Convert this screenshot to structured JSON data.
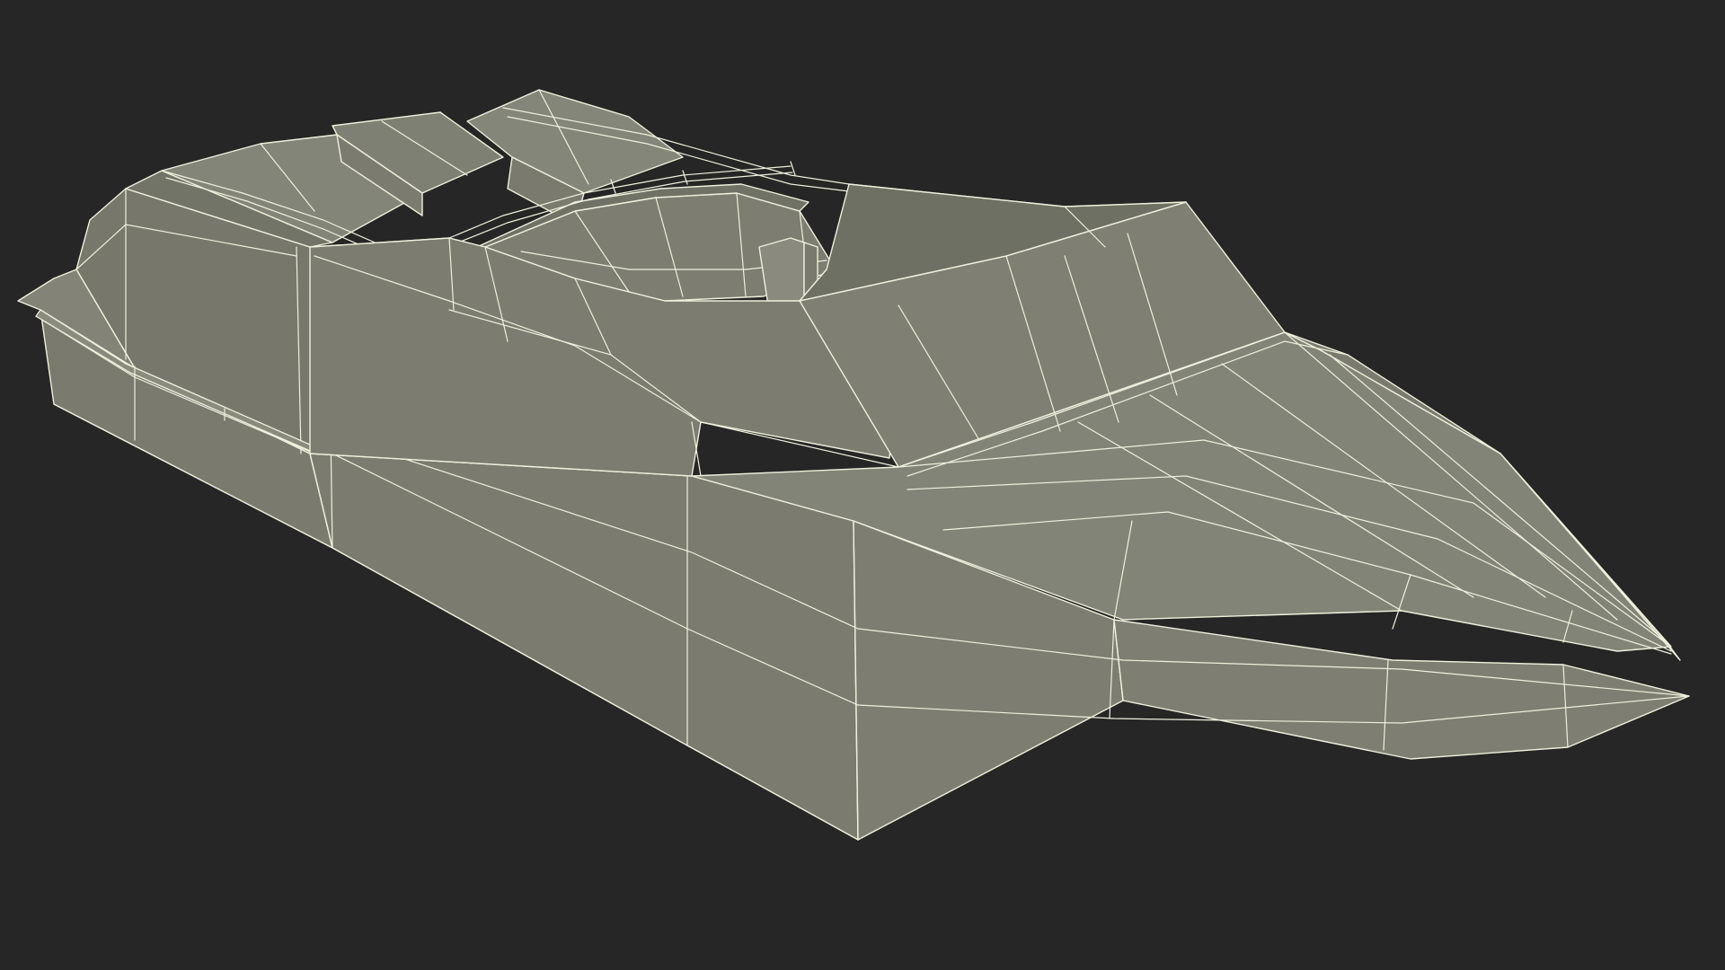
{
  "viewport": {
    "background_color": "#262626"
  },
  "model": {
    "subject": "speedboat-hull-wireframe",
    "surface_color": "#7b7c6f",
    "surface_dark_color": "#6e6f63",
    "surface_light_color": "#86877a",
    "wire_color": "#eef0dc"
  }
}
